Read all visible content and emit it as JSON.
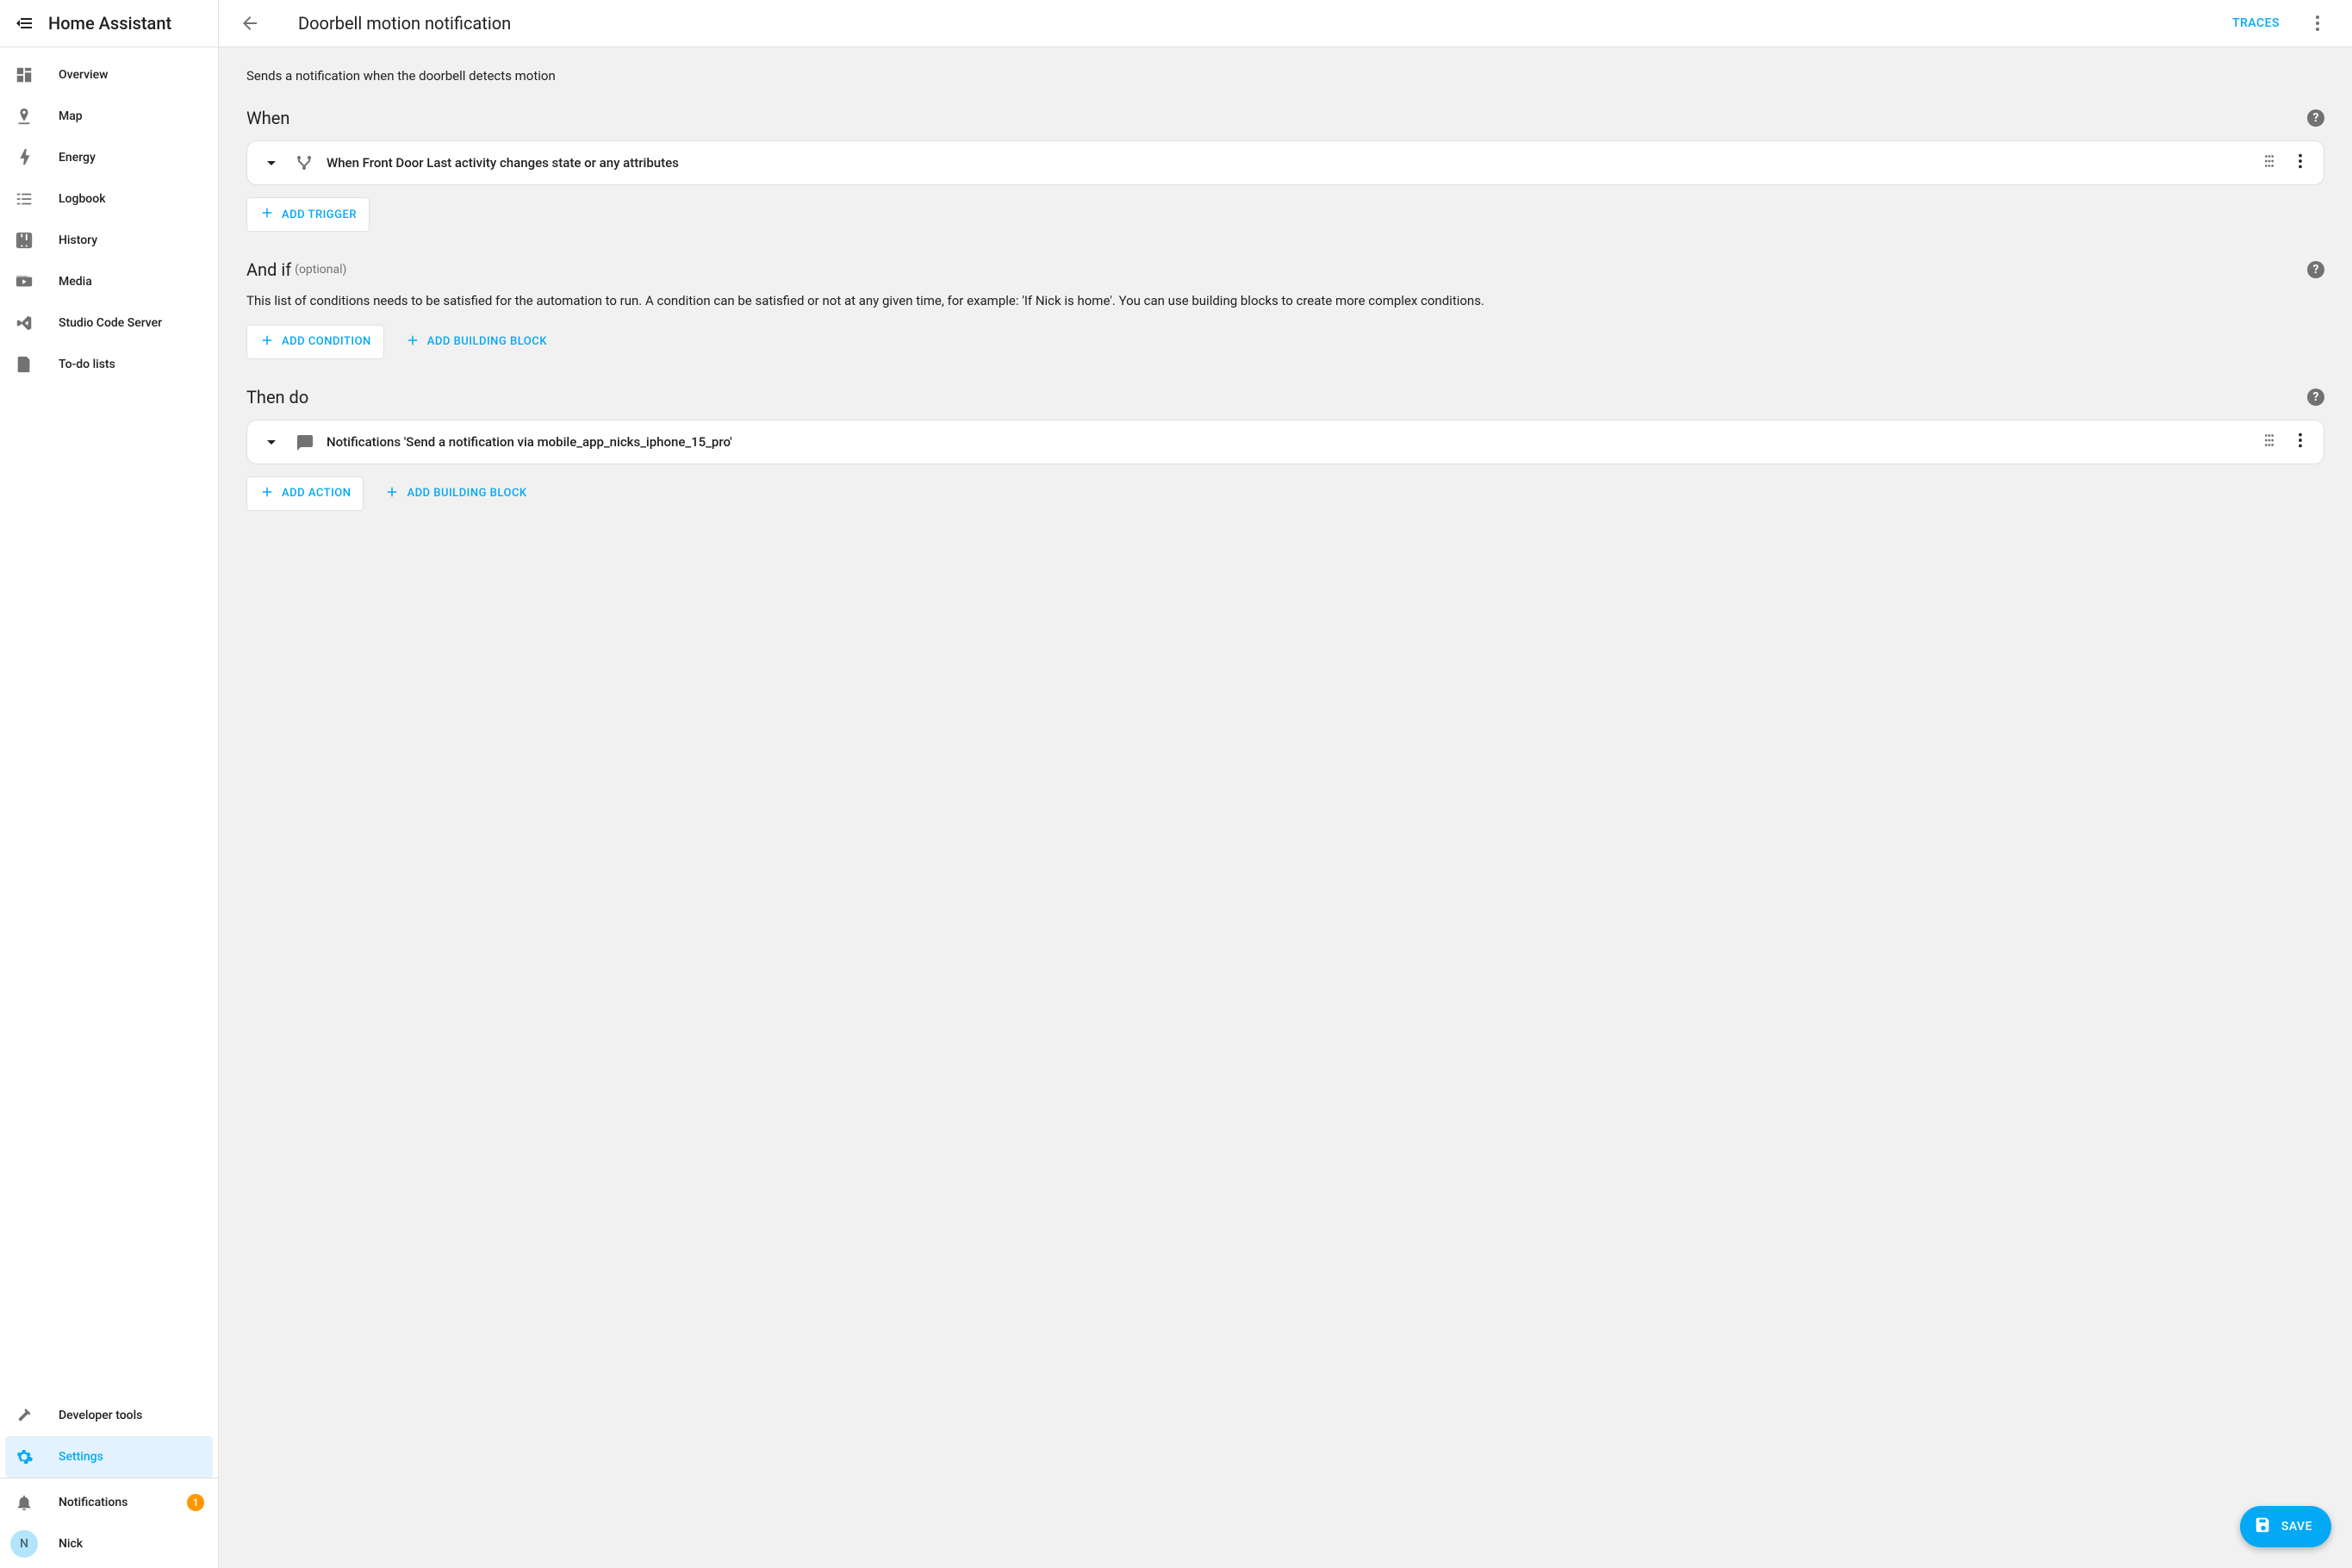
{
  "app_title": "Home Assistant",
  "sidebar": {
    "items": [
      {
        "icon": "overview",
        "label": "Overview"
      },
      {
        "icon": "map",
        "label": "Map"
      },
      {
        "icon": "energy",
        "label": "Energy"
      },
      {
        "icon": "logbook",
        "label": "Logbook"
      },
      {
        "icon": "history",
        "label": "History"
      },
      {
        "icon": "media",
        "label": "Media"
      },
      {
        "icon": "vscode",
        "label": "Studio Code Server"
      },
      {
        "icon": "todo",
        "label": "To-do lists"
      }
    ],
    "dev_tools": "Developer tools",
    "settings": "Settings",
    "notifications_label": "Notifications",
    "notifications_count": "1",
    "user_initial": "N",
    "user_name": "Nick"
  },
  "topbar": {
    "title": "Doorbell motion notification",
    "traces": "TRACES"
  },
  "automation": {
    "description": "Sends a notification when the doorbell detects motion",
    "when": {
      "title": "When",
      "triggers": [
        {
          "label": "When Front Door Last activity changes state or any attributes"
        }
      ],
      "add_trigger": "ADD TRIGGER"
    },
    "and_if": {
      "title": "And if",
      "optional": "(optional)",
      "text": "This list of conditions needs to be satisfied for the automation to run. A condition can be satisfied or not at any given time, for example: 'If Nick is home'. You can use building blocks to create more complex conditions.",
      "add_condition": "ADD CONDITION",
      "add_block": "ADD BUILDING BLOCK"
    },
    "then_do": {
      "title": "Then do",
      "actions": [
        {
          "label": "Notifications 'Send a notification via mobile_app_nicks_iphone_15_pro'"
        }
      ],
      "add_action": "ADD ACTION",
      "add_block": "ADD BUILDING BLOCK"
    }
  },
  "save_button": "SAVE"
}
